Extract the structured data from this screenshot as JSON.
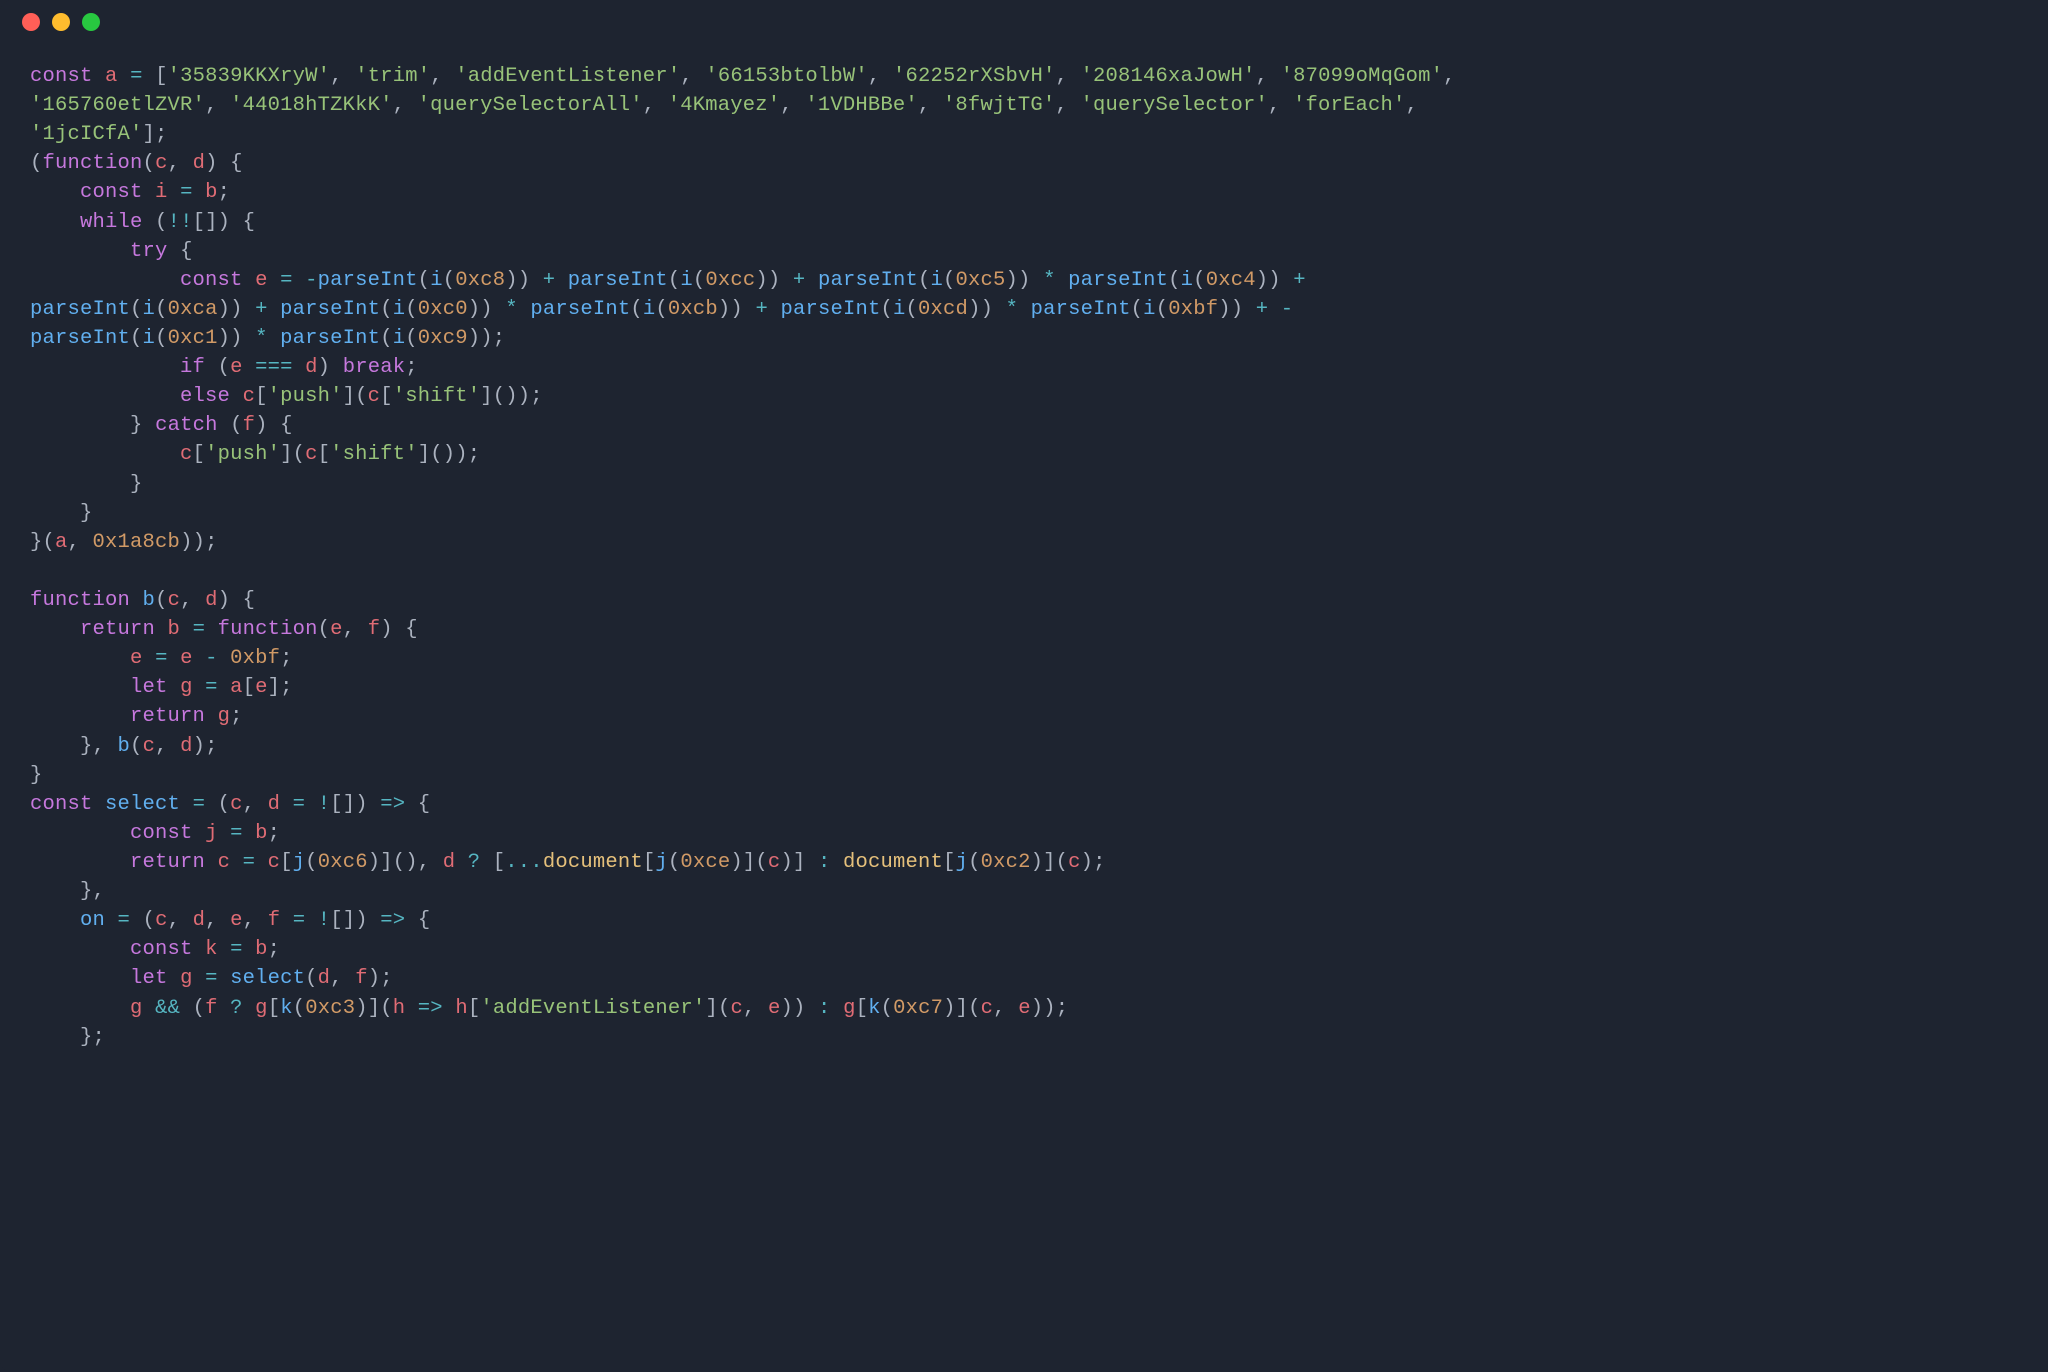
{
  "window": {
    "traffic_lights": [
      "close",
      "minimize",
      "zoom"
    ]
  },
  "code": {
    "array_literal": [
      "35839KKXryW",
      "trim",
      "addEventListener",
      "66153btolbW",
      "62252rXSbvH",
      "208146xaJowH",
      "87099oMqGom",
      "165760etlZVR",
      "44018hTZKkK",
      "querySelectorAll",
      "4Kmayez",
      "1VDHBBe",
      "8fwjtTG",
      "querySelector",
      "forEach",
      "1jcICfA"
    ],
    "iife_arg2": "0x1a8cb",
    "hex_vals": {
      "xc8": "0xc8",
      "xcc": "0xcc",
      "xc5": "0xc5",
      "xc4": "0xc4",
      "xca": "0xca",
      "xc0": "0xc0",
      "xcb": "0xcb",
      "xcd": "0xcd",
      "xbf": "0xbf",
      "xc1": "0xc1",
      "xc9": "0xc9",
      "xc6": "0xc6",
      "xce": "0xce",
      "xc2": "0xc2",
      "xc3": "0xc3",
      "xc7": "0xc7"
    },
    "str_push": "push",
    "str_shift": "shift",
    "str_addEventListener": "addEventListener",
    "kw_const": "const",
    "kw_function": "function",
    "kw_while": "while",
    "kw_try": "try",
    "kw_catch": "catch",
    "kw_if": "if",
    "kw_else": "else",
    "kw_break": "break",
    "kw_return": "return",
    "kw_let": "let",
    "id_a": "a",
    "id_b": "b",
    "id_c": "c",
    "id_d": "d",
    "id_e": "e",
    "id_f": "f",
    "id_g": "g",
    "id_h": "h",
    "id_i": "i",
    "id_j": "j",
    "id_k": "k",
    "id_select": "select",
    "id_on": "on",
    "fn_parseInt": "parseInt",
    "prop_document": "document"
  }
}
